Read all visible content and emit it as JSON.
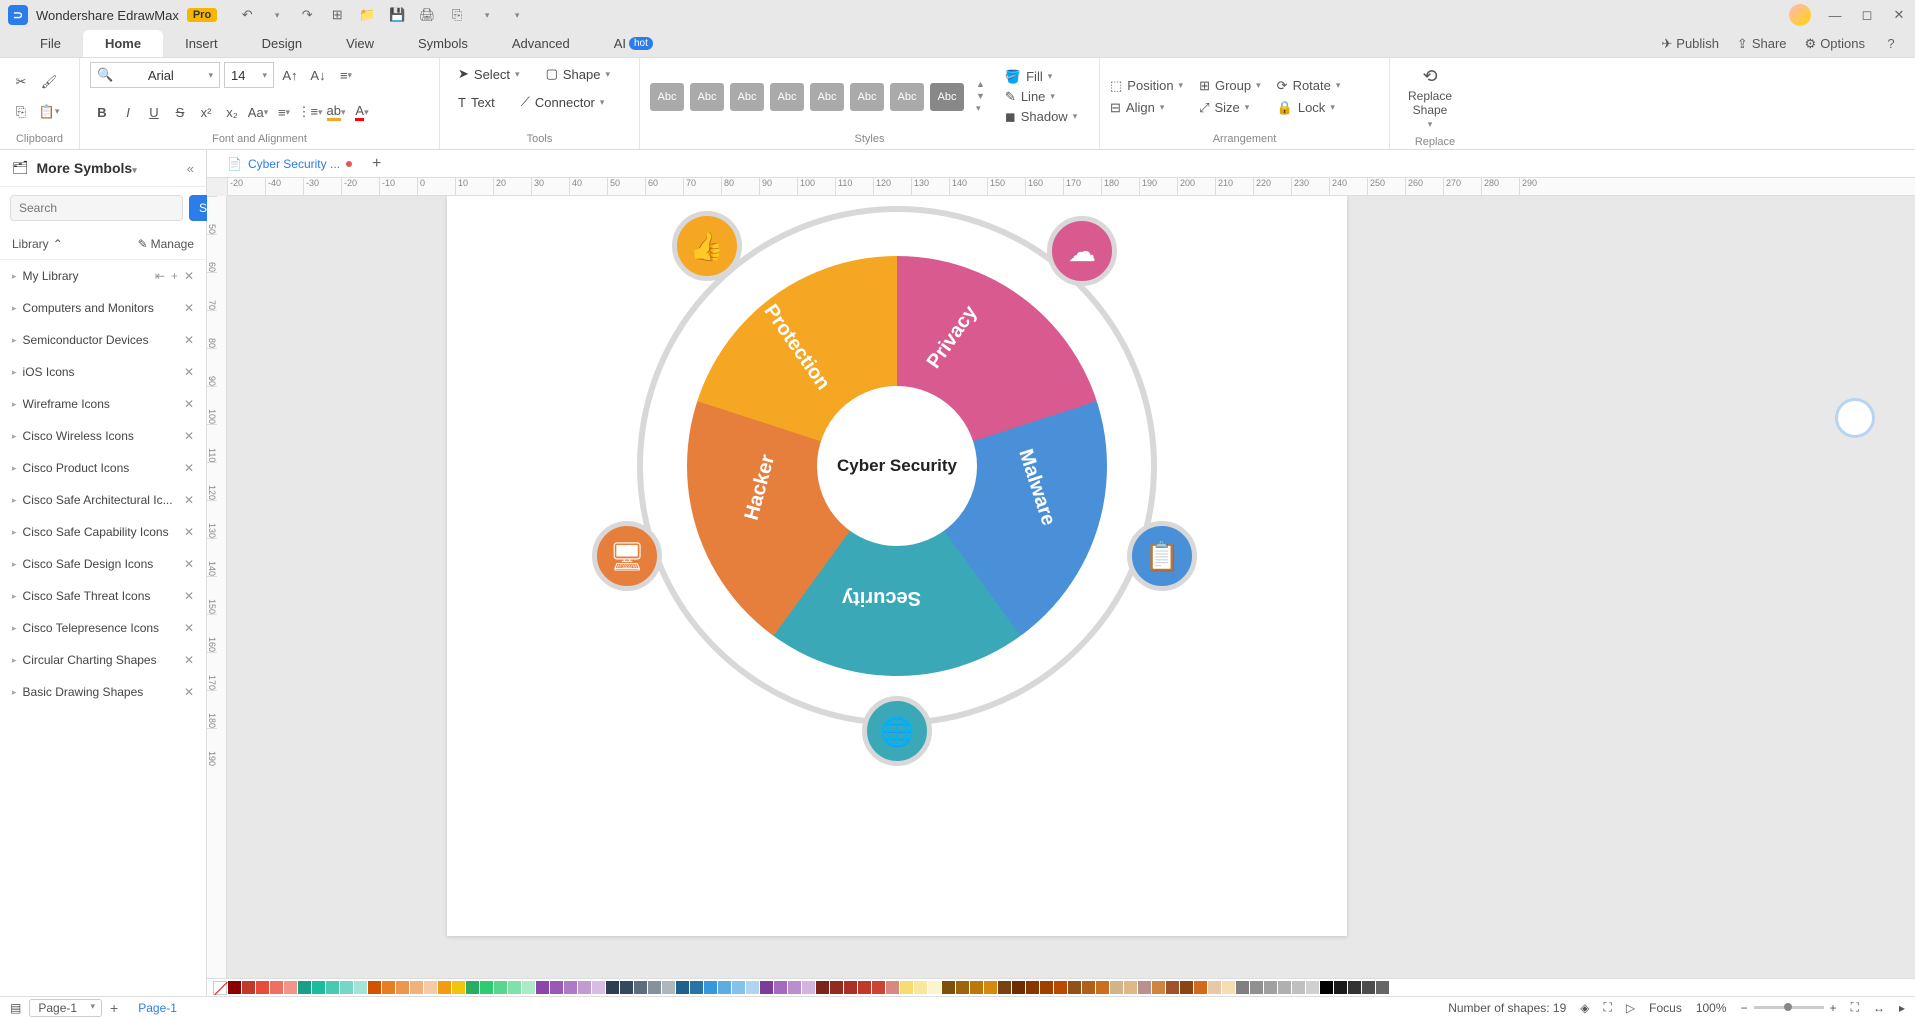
{
  "app": {
    "title": "Wondershare EdrawMax",
    "pro": "Pro"
  },
  "menus": [
    "File",
    "Home",
    "Insert",
    "Design",
    "View",
    "Symbols",
    "Advanced",
    "AI"
  ],
  "menu_active": 1,
  "hot": "hot",
  "menu_right": {
    "publish": "Publish",
    "share": "Share",
    "options": "Options"
  },
  "ribbon": {
    "clipboard": "Clipboard",
    "font_align": "Font and Alignment",
    "font_name": "Arial",
    "font_size": "14",
    "tools": "Tools",
    "select": "Select",
    "text": "Text",
    "shape": "Shape",
    "connector": "Connector",
    "styles": "Styles",
    "swatch": "Abc",
    "fill": "Fill",
    "line": "Line",
    "shadow": "Shadow",
    "arrangement": "Arrangement",
    "position": "Position",
    "align": "Align",
    "group": "Group",
    "size": "Size",
    "rotate": "Rotate",
    "lock": "Lock",
    "replace": "Replace",
    "replace_shape": "Replace\nShape"
  },
  "sidebar": {
    "title": "More Symbols",
    "search_ph": "Search",
    "search_btn": "Search",
    "library": "Library",
    "manage": "Manage",
    "mylib": "My Library",
    "items": [
      "Computers and Monitors",
      "Semiconductor Devices",
      "iOS Icons",
      "Wireframe Icons",
      "Cisco Wireless Icons",
      "Cisco Product Icons",
      "Cisco Safe Architectural Ic...",
      "Cisco Safe Capability Icons",
      "Cisco Safe Design Icons",
      "Cisco Safe Threat Icons",
      "Cisco Telepresence Icons",
      "Circular Charting Shapes",
      "Basic Drawing Shapes"
    ]
  },
  "doc": {
    "tab": "Cyber Security ..."
  },
  "ruler_h": [
    "-20",
    "-40",
    "-30",
    "-20",
    "-10",
    "0",
    "10",
    "20",
    "30",
    "40",
    "50",
    "60",
    "70",
    "80",
    "90",
    "100",
    "110",
    "120",
    "130",
    "140",
    "150",
    "160",
    "170",
    "180",
    "190",
    "200",
    "210",
    "220",
    "230",
    "240",
    "250",
    "260",
    "270",
    "280",
    "290"
  ],
  "ruler_v": [
    "50",
    "60",
    "70",
    "80",
    "90",
    "100",
    "110",
    "120",
    "130",
    "140",
    "150",
    "160",
    "170",
    "180",
    "190"
  ],
  "diagram": {
    "center": "Cyber Security",
    "segments": [
      {
        "label": "Protection",
        "color": "#f5a623"
      },
      {
        "label": "Privacy",
        "color": "#d85a8f"
      },
      {
        "label": "Malware",
        "color": "#4a90d9"
      },
      {
        "label": "Security",
        "color": "#3ba8b8"
      },
      {
        "label": "Hacker",
        "color": "#e67e3c"
      }
    ]
  },
  "colors": [
    "#8b0000",
    "#c0392b",
    "#e74c3c",
    "#ec7063",
    "#f1948a",
    "#16a085",
    "#1abc9c",
    "#48c9b0",
    "#76d7c4",
    "#a3e4d7",
    "#d35400",
    "#e67e22",
    "#eb984e",
    "#f0b27a",
    "#f5cba7",
    "#f39c12",
    "#f1c40f",
    "#27ae60",
    "#2ecc71",
    "#58d68d",
    "#82e0aa",
    "#abebc6",
    "#8e44ad",
    "#9b59b6",
    "#af7ac5",
    "#c39bd3",
    "#d7bde2",
    "#2c3e50",
    "#34495e",
    "#5d6d7e",
    "#85929e",
    "#aeb6bf",
    "#1f618d",
    "#2874a6",
    "#3498db",
    "#5dade2",
    "#85c1e9",
    "#aed6f1",
    "#7d3c98",
    "#a569bd",
    "#bb8fce",
    "#d2b4de",
    "#7b241c",
    "#922b21",
    "#a93226",
    "#c0392b",
    "#cb4335",
    "#d98880",
    "#f7dc6f",
    "#f9e79f",
    "#fcf3cf",
    "#7e5109",
    "#9c640c",
    "#b9770e",
    "#d68910",
    "#784212",
    "#6e2c00",
    "#873600",
    "#a04000",
    "#ba4a00",
    "#935116",
    "#af601a",
    "#ca6f1e",
    "#d2b48c",
    "#deb887",
    "#bc8f8f",
    "#cd853f",
    "#a0522d",
    "#8b4513",
    "#d2691e",
    "#e6c9a8",
    "#f5deb3",
    "#808080",
    "#909090",
    "#a0a0a0",
    "#b0b0b0",
    "#c0c0c0",
    "#d0d0d0",
    "#000000",
    "#1a1a1a",
    "#333333",
    "#4d4d4d",
    "#666666",
    "#ffffff"
  ],
  "status": {
    "page_sel": "Page-1",
    "crumb": "Page-1",
    "shapes": "Number of shapes: 19",
    "focus": "Focus",
    "zoom": "100%"
  }
}
